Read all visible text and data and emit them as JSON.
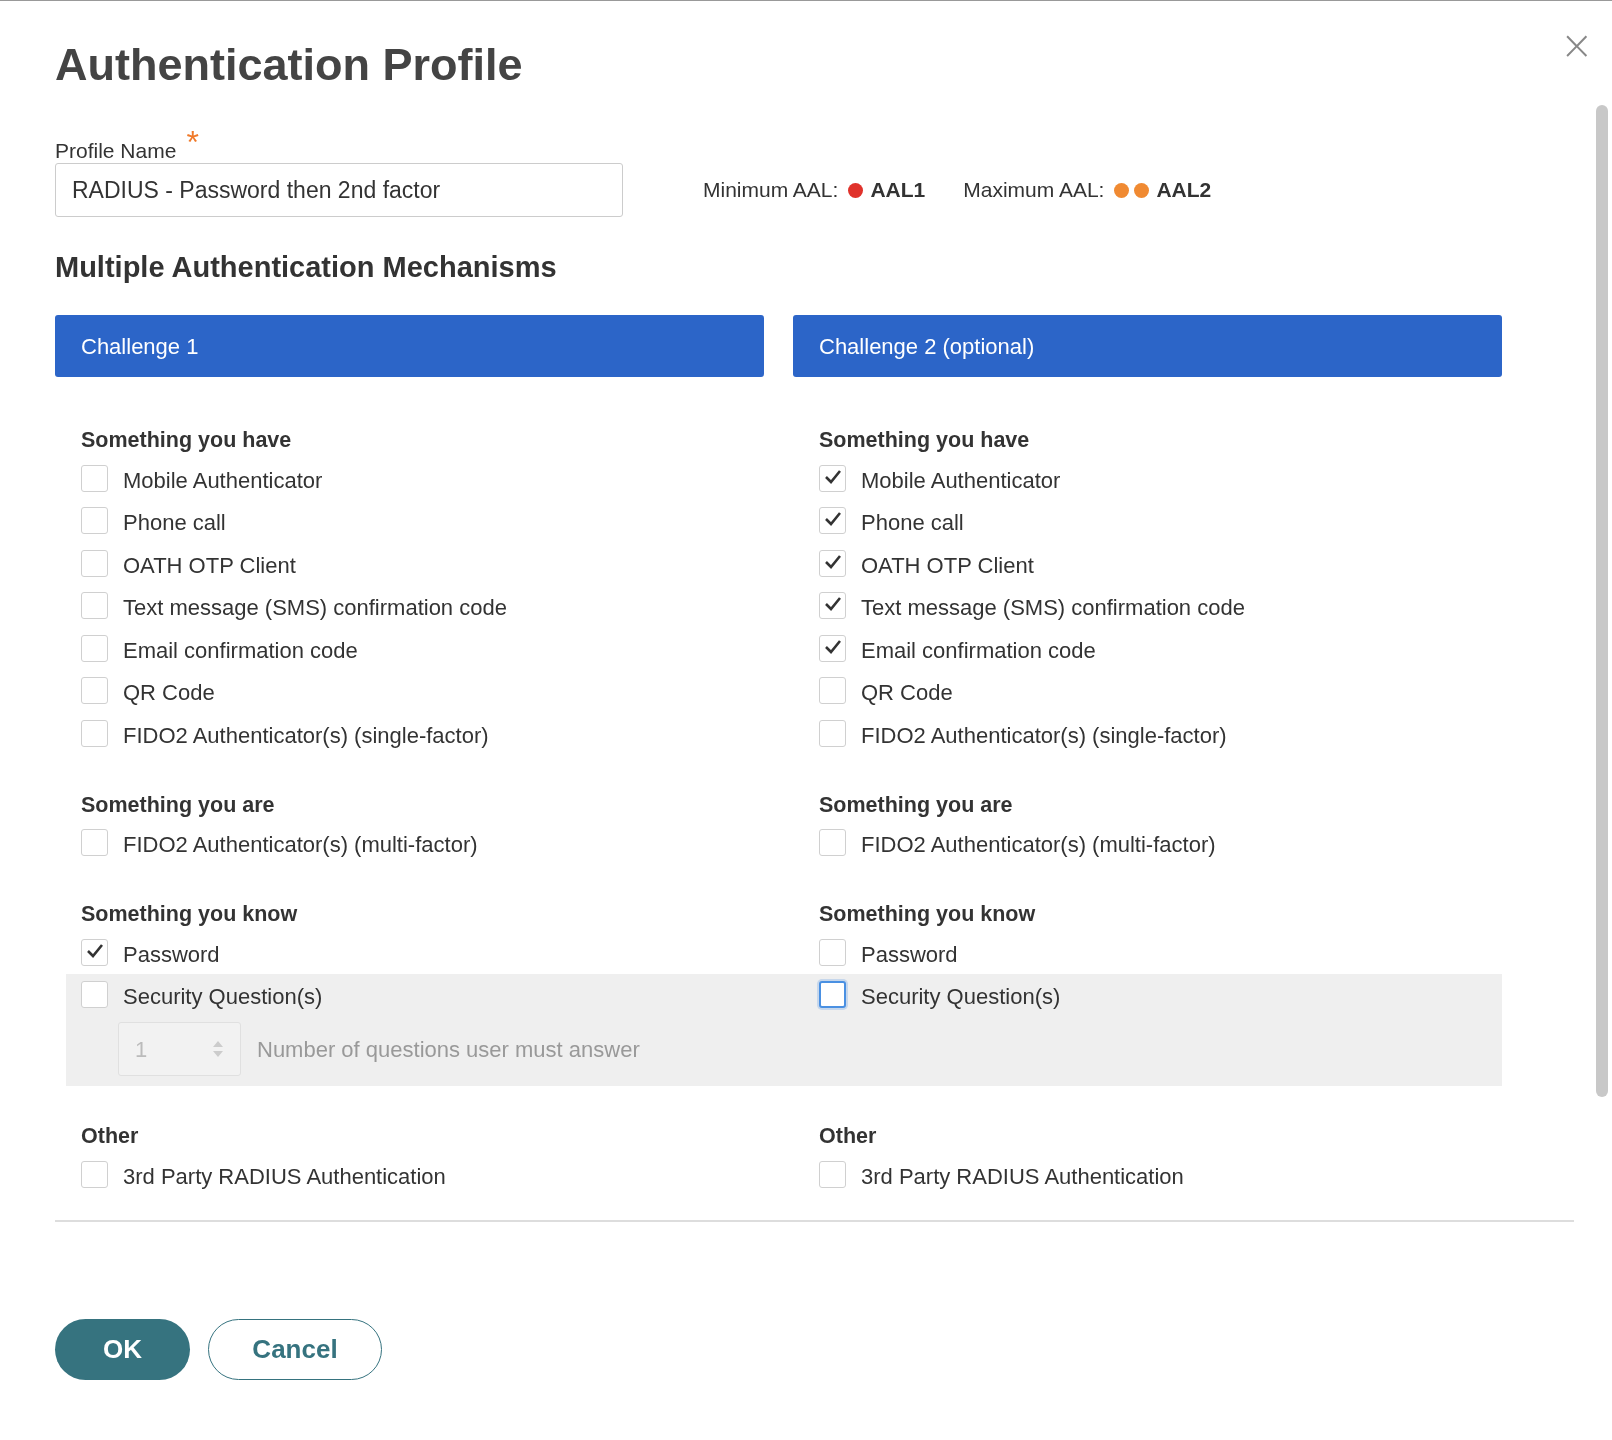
{
  "dialog": {
    "title": "Authentication Profile",
    "close": "×"
  },
  "profile_name": {
    "label": "Profile Name",
    "required_mark": "*",
    "value": "RADIUS - Password then 2nd factor"
  },
  "aal": [
    {
      "label": "Minimum AAL:",
      "dots": [
        {
          "color": "#e0322b"
        }
      ],
      "value": "AAL1"
    },
    {
      "label": "Maximum AAL:",
      "dots": [
        {
          "color": "#f08a32"
        },
        {
          "color": "#f08a32"
        }
      ],
      "value": "AAL2"
    }
  ],
  "section_title": "Multiple Authentication Mechanisms",
  "challenges": [
    {
      "title": "Challenge 1",
      "groups": [
        {
          "title": "Something you have",
          "items": [
            {
              "label": "Mobile Authenticator",
              "checked": false
            },
            {
              "label": "Phone call",
              "checked": false
            },
            {
              "label": "OATH OTP Client",
              "checked": false
            },
            {
              "label": "Text message (SMS) confirmation code",
              "checked": false
            },
            {
              "label": "Email confirmation code",
              "checked": false
            },
            {
              "label": "QR Code",
              "checked": false
            },
            {
              "label": "FIDO2 Authenticator(s) (single-factor)",
              "checked": false
            }
          ]
        },
        {
          "title": "Something you are",
          "items": [
            {
              "label": "FIDO2 Authenticator(s) (multi-factor)",
              "checked": false
            }
          ]
        },
        {
          "title": "Something you know",
          "items": [
            {
              "label": "Password",
              "checked": true
            },
            {
              "label": "Security Question(s)",
              "checked": false,
              "highlighted": true,
              "questions": {
                "value": "1",
                "label": "Number of questions user must answer",
                "disabled": true
              }
            }
          ]
        },
        {
          "title": "Other",
          "items": [
            {
              "label": "3rd Party RADIUS Authentication",
              "checked": false
            }
          ]
        }
      ]
    },
    {
      "title": "Challenge 2 (optional)",
      "groups": [
        {
          "title": "Something you have",
          "items": [
            {
              "label": "Mobile Authenticator",
              "checked": true
            },
            {
              "label": "Phone call",
              "checked": true
            },
            {
              "label": "OATH OTP Client",
              "checked": true
            },
            {
              "label": "Text message (SMS) confirmation code",
              "checked": true
            },
            {
              "label": "Email confirmation code",
              "checked": true
            },
            {
              "label": "QR Code",
              "checked": false
            },
            {
              "label": "FIDO2 Authenticator(s) (single-factor)",
              "checked": false
            }
          ]
        },
        {
          "title": "Something you are",
          "items": [
            {
              "label": "FIDO2 Authenticator(s) (multi-factor)",
              "checked": false
            }
          ]
        },
        {
          "title": "Something you know",
          "items": [
            {
              "label": "Password",
              "checked": false
            },
            {
              "label": "Security Question(s)",
              "checked": false,
              "highlighted": true,
              "focused": true
            }
          ]
        },
        {
          "title": "Other",
          "items": [
            {
              "label": "3rd Party RADIUS Authentication",
              "checked": false
            }
          ]
        }
      ]
    }
  ],
  "buttons": [
    {
      "label": "OK",
      "kind": "primary"
    },
    {
      "label": "Cancel",
      "kind": "secondary"
    }
  ]
}
